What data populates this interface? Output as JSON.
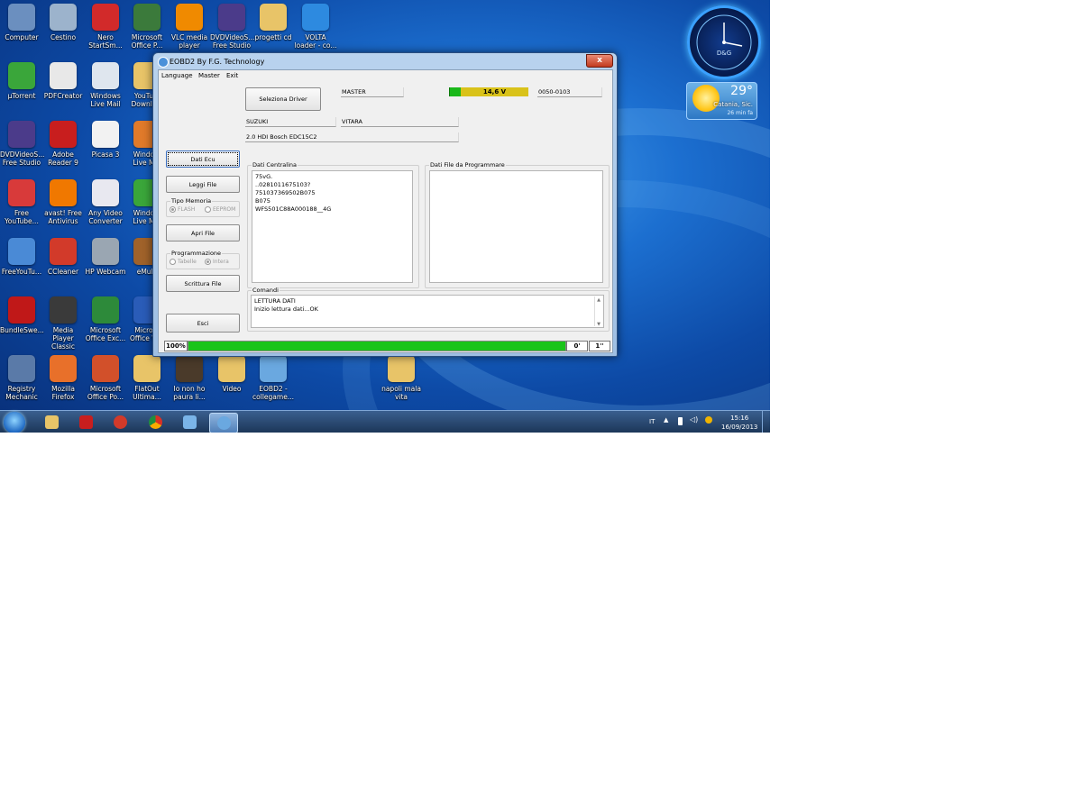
{
  "desktop_icons": [
    {
      "label": "Computer",
      "icon": "computer-icon",
      "color": "#6b8fbf"
    },
    {
      "label": "Cestino",
      "icon": "recycle-bin-icon",
      "color": "#9cb3cc"
    },
    {
      "label": "Nero\nStartSm...",
      "icon": "nero-icon",
      "color": "#d22a2a"
    },
    {
      "label": "Microsoft\nOffice P...",
      "icon": "office-icon",
      "color": "#3b7a3b"
    },
    {
      "label": "VLC media\nplayer",
      "icon": "vlc-icon",
      "color": "#f08a00"
    },
    {
      "label": "DVDVideoS...\nFree Studio",
      "icon": "dvdvideosoft-icon",
      "color": "#4b3b8a"
    },
    {
      "label": "progetti cd",
      "icon": "folder-icon",
      "color": "#e8c468"
    },
    {
      "label": "VOLTA\nloader - co...",
      "icon": "accessibility-icon",
      "color": "#2d8ae0"
    },
    {
      "label": "µTorrent",
      "icon": "utorrent-icon",
      "color": "#3aa63a"
    },
    {
      "label": "PDFCreator",
      "icon": "pdfcreator-icon",
      "color": "#e8e8e8"
    },
    {
      "label": "Windows\nLive Mail",
      "icon": "live-mail-icon",
      "color": "#dfe6ee"
    },
    {
      "label": "YouTu...\nDownlo...",
      "icon": "folder-icon",
      "color": "#e8c468"
    },
    {
      "label": "DVDVideoS...\nFree Studio",
      "icon": "dvdvideosoft-icon",
      "color": "#4b3b8a"
    },
    {
      "label": "Adobe\nReader 9",
      "icon": "adobe-reader-icon",
      "color": "#c81e1e"
    },
    {
      "label": "Picasa 3",
      "icon": "picasa-icon",
      "color": "#f2f2f2"
    },
    {
      "label": "Windo...\nLive M...",
      "icon": "windows-live-icon",
      "color": "#e07a2a"
    },
    {
      "label": "Free\nYouTube...",
      "icon": "free-youtube-icon",
      "color": "#d83a3a"
    },
    {
      "label": "avast! Free\nAntivirus",
      "icon": "avast-icon",
      "color": "#f07800"
    },
    {
      "label": "Any Video\nConverter",
      "icon": "video-converter-icon",
      "color": "#e8e8f0"
    },
    {
      "label": "Windo...\nLive M...",
      "icon": "windows-live-icon",
      "color": "#3aa63a"
    },
    {
      "label": "FreeYouTu...",
      "icon": "free-youtube-icon",
      "color": "#4a8ad6"
    },
    {
      "label": "CCleaner",
      "icon": "ccleaner-icon",
      "color": "#d23a2a"
    },
    {
      "label": "HP Webcam",
      "icon": "webcam-icon",
      "color": "#9aa6b2"
    },
    {
      "label": "eMule",
      "icon": "emule-icon",
      "color": "#a0622a"
    },
    {
      "label": "BundleSwe...",
      "icon": "bundlesweeper-icon",
      "color": "#c01818"
    },
    {
      "label": "Media Player\nClassic",
      "icon": "media-player-icon",
      "color": "#3a3a3a"
    },
    {
      "label": "Microsoft\nOffice Exc...",
      "icon": "excel-icon",
      "color": "#2d8a3a"
    },
    {
      "label": "Micro...\nOffice W...",
      "icon": "word-icon",
      "color": "#2a5cb8"
    },
    {
      "label": "Registry\nMechanic",
      "icon": "registry-mechanic-icon",
      "color": "#5a7aa8"
    },
    {
      "label": "Mozilla\nFirefox",
      "icon": "firefox-icon",
      "color": "#e8702a"
    },
    {
      "label": "Microsoft\nOffice Po...",
      "icon": "powerpoint-icon",
      "color": "#d2502a"
    },
    {
      "label": "FlatOut\nUltima...",
      "icon": "folder-icon",
      "color": "#e8c468"
    },
    {
      "label": "Io non ho\npaura li...",
      "icon": "video-file-icon",
      "color": "#4a3a2a"
    },
    {
      "label": "Video",
      "icon": "folder-icon",
      "color": "#e8c468"
    },
    {
      "label": "EOBD2 -\ncollegame...",
      "icon": "eobd2-icon",
      "color": "#6aa8e0"
    },
    {
      "label": "napoli mala\nvita",
      "icon": "folder-icon",
      "color": "#e8c468"
    }
  ],
  "gadgets": {
    "clock_brand": "D&G",
    "weather_temp": "29°",
    "weather_city": "Catania, Sic.",
    "weather_ago": "26 min fa"
  },
  "taskbar": {
    "language": "IT",
    "time": "15:16",
    "date": "16/09/2013"
  },
  "window": {
    "title": "EOBD2 By F.G. Technology",
    "close": "x",
    "menu": [
      "Language",
      "Master",
      "Exit"
    ],
    "select_driver_button": "Seleziona Driver",
    "master_field": "MASTER",
    "voltage": "14,6 V",
    "version": "0050-0103",
    "make": "SUZUKI",
    "model": "VITARA",
    "engine": "2.0  HDI  Bosch EDC15C2",
    "buttons": {
      "dati_ecu": "Dati Ecu",
      "leggi_file": "Leggi File",
      "apri_file": "Apri File",
      "scrittura_file": "Scrittura File",
      "esci": "Esci"
    },
    "tipo_memoria": {
      "title": "Tipo Memoria",
      "opt1": "FLASH",
      "opt2": "EEPROM"
    },
    "programmazione": {
      "title": "Programmazione",
      "opt1": "Tabelle",
      "opt2": "Intera"
    },
    "dati_centralina": {
      "title": "Dati Centralina",
      "lines": [
        "75vG.",
        "..0281011675103?",
        "751037369502B075",
        "B075",
        "WFS501C88A000188__4G"
      ]
    },
    "dati_file": {
      "title": "Dati File da Programmare"
    },
    "comandi": {
      "title": "Comandi",
      "lines": [
        "LETTURA DATI",
        "Inizio lettura dati...OK"
      ]
    },
    "progress": {
      "label": "100%",
      "value": 100,
      "time1": "0'",
      "time2": "1''"
    }
  },
  "colors": {
    "progress_green": "#1ac41a",
    "voltage_yellow": "#d9c21a",
    "voltage_green": "#1ab81a"
  }
}
